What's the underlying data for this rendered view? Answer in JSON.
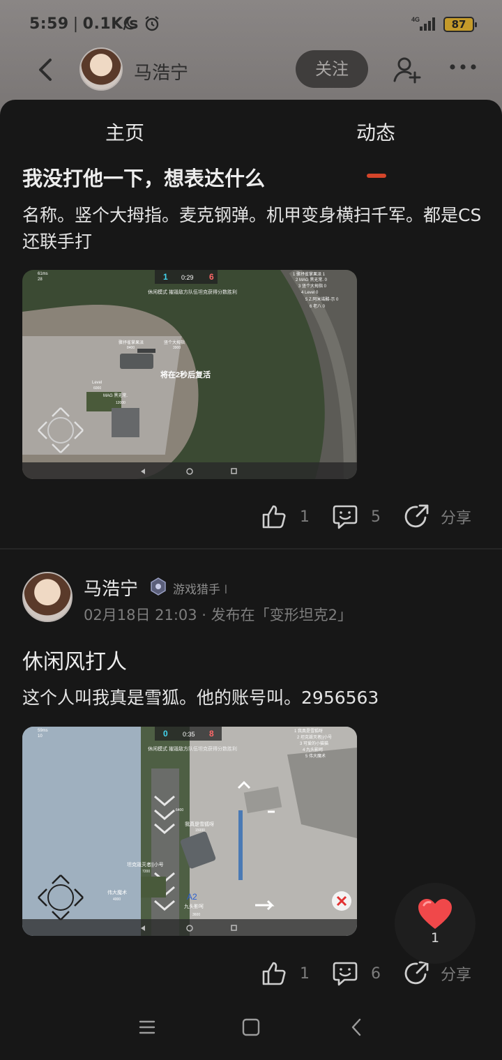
{
  "status_bar": {
    "time": "5:59",
    "speed": "0.1K/s",
    "network": "4G",
    "battery": "87"
  },
  "header": {
    "username": "马浩宁",
    "follow_label": "关注"
  },
  "tabs": [
    {
      "label": "主页"
    },
    {
      "label": "动态"
    }
  ],
  "posts": [
    {
      "title": "我没打他一下，想表达什么",
      "text": "名称。竖个大拇指。麦克钢弹。机甲变身横扫千军。都是CS还联手打",
      "likes": "1",
      "comments": "5",
      "share_label": "分享"
    },
    {
      "author": "马浩宁",
      "badge": "游戏猎手",
      "meta": "02月18日 21:03 · 发布在「变形坦克2」",
      "title": "休闲风打人",
      "text": "这个人叫我真是雪狐。他的账号叫。2956563",
      "likes": "1",
      "comments": "6",
      "share_label": "分享"
    }
  ],
  "screenshot1": {
    "ping": "61ms",
    "fps": "28",
    "score_blue": "1",
    "timer": "0:29",
    "score_red": "6",
    "mode_text": "休闲模式  摧毁敌方队伍坦克获得分数胜利",
    "respawn_text": "将在2秒后复活",
    "scoreboard": [
      "1 骤抒雀掌果派  1",
      "2 MAG 黑无常.  0",
      "3 竖个大拇指  0",
      "4 Level  0",
      "5 Z.阿米诺酸-示  0",
      "6 老八  0"
    ],
    "labels": [
      "骤抒雀掌果派",
      "竖个大拇指",
      "Level",
      "MAG 黑无常."
    ],
    "label_values": [
      "8400",
      "3900",
      "6000",
      "12000"
    ]
  },
  "screenshot2": {
    "ping": "59ms",
    "fps": "10",
    "score_blue": "0",
    "timer": "0:35",
    "score_red": "8",
    "mode_text": "休闲模式  摧毁敌方队伍坦克获得分数胜利",
    "scoreboard": [
      "1 我真是雪狐呀",
      "2 坦克毁灭者||小号",
      "3 可爱的小猫猫",
      "4 九头影呵",
      "5 伟大魔术"
    ],
    "labels": [
      "我真是雪狐呀",
      "坦克毁灭者||小号",
      "伟大魔术",
      "九头影呵",
      "A2"
    ],
    "label_values": [
      "6400",
      "15000",
      "7200",
      "4000",
      "3600"
    ]
  },
  "fab": {
    "count": "1"
  }
}
